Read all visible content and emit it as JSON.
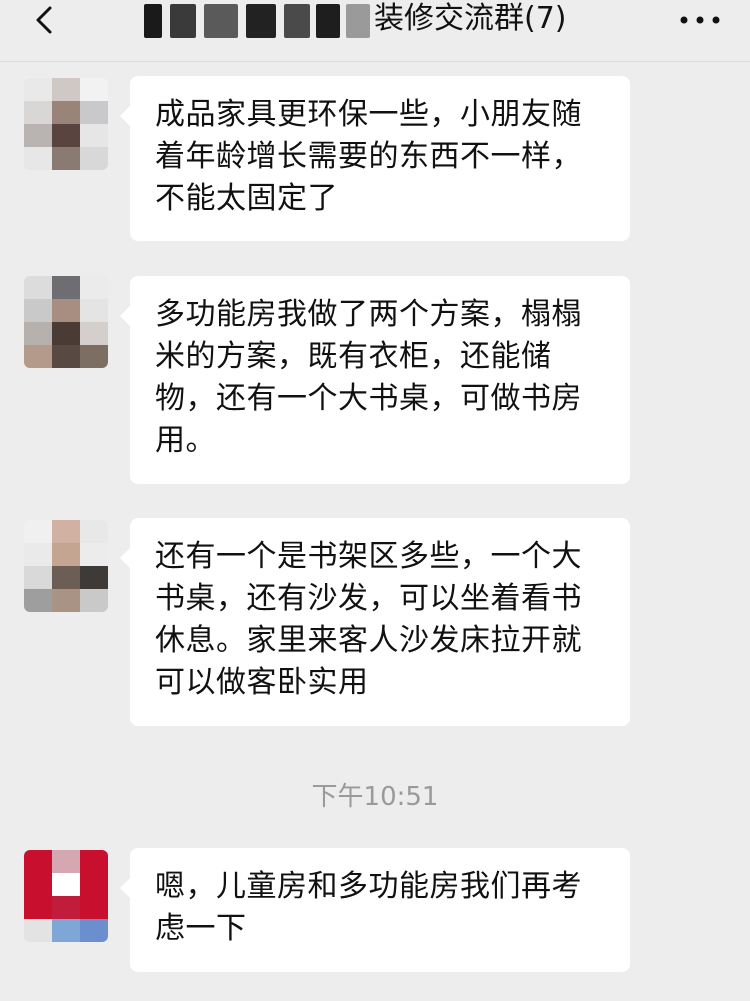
{
  "header": {
    "title": "装修交流群(7)",
    "back_icon": "chevron-left-icon",
    "more_icon": "more-dots-icon"
  },
  "messages": [
    {
      "text": "成品家具更环保一些，小朋友随着年龄增长需要的东西不一样，不能太固定了"
    },
    {
      "text": "多功能房我做了两个方案，榻榻米的方案，既有衣柜，还能储物，还有一个大书桌，可做书房用。"
    },
    {
      "text": "还有一个是书架区多些，一个大书桌，还有沙发，可以坐着看书休息。家里来客人沙发床拉开就可以做客卧实用"
    },
    {
      "text": "嗯，儿童房和多功能房我们再考虑一下"
    }
  ],
  "timestamp": "下午10:51"
}
